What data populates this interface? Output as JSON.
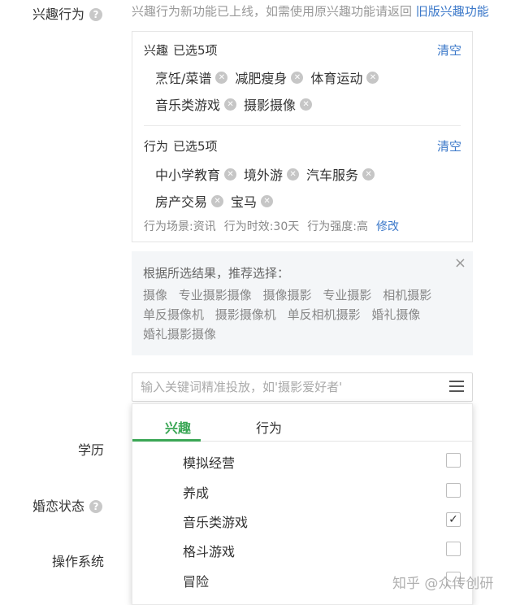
{
  "form": {
    "interest_behavior_label": "兴趣行为",
    "education_label": "学历",
    "marital_label": "婚恋状态",
    "os_label": "操作系统",
    "help_glyph": "?"
  },
  "notice": {
    "text": "兴趣行为新功能已上线，如需使用原兴趣功能请返回",
    "link": "旧版兴趣功能"
  },
  "interest": {
    "heading": "兴趣",
    "count": "已选5项",
    "clear": "清空",
    "tags": [
      "烹饪/菜谱",
      "减肥瘦身",
      "体育运动",
      "音乐类游戏",
      "摄影摄像"
    ]
  },
  "behavior": {
    "heading": "行为",
    "count": "已选5项",
    "clear": "清空",
    "tags": [
      "中小学教育",
      "境外游",
      "汽车服务",
      "房产交易",
      "宝马"
    ],
    "scene": "行为场景:资讯",
    "timeliness": "行为时效:30天",
    "strength": "行为强度:高",
    "edit": "修改"
  },
  "recommend": {
    "title": "根据所选结果，推荐选择：",
    "close": "×",
    "items": [
      "摄像",
      "专业摄影摄像",
      "摄像摄影",
      "专业摄影",
      "相机摄影",
      "单反摄像机",
      "摄影摄像机",
      "单反相机摄影",
      "婚礼摄像",
      "婚礼摄影摄像"
    ]
  },
  "search": {
    "placeholder": "输入关键词精准投放，如'摄影爱好者'"
  },
  "dropdown": {
    "tabs": [
      "兴趣",
      "行为"
    ],
    "active_tab": "兴趣",
    "options": [
      {
        "label": "模拟经营",
        "checked": false
      },
      {
        "label": "养成",
        "checked": false
      },
      {
        "label": "音乐类游戏",
        "checked": true
      },
      {
        "label": "格斗游戏",
        "checked": false
      },
      {
        "label": "冒险",
        "checked": false
      }
    ]
  },
  "watermark": "知乎 @众传创研",
  "colors": {
    "accent_green": "#3aa655",
    "link_blue": "#3b78c9"
  }
}
